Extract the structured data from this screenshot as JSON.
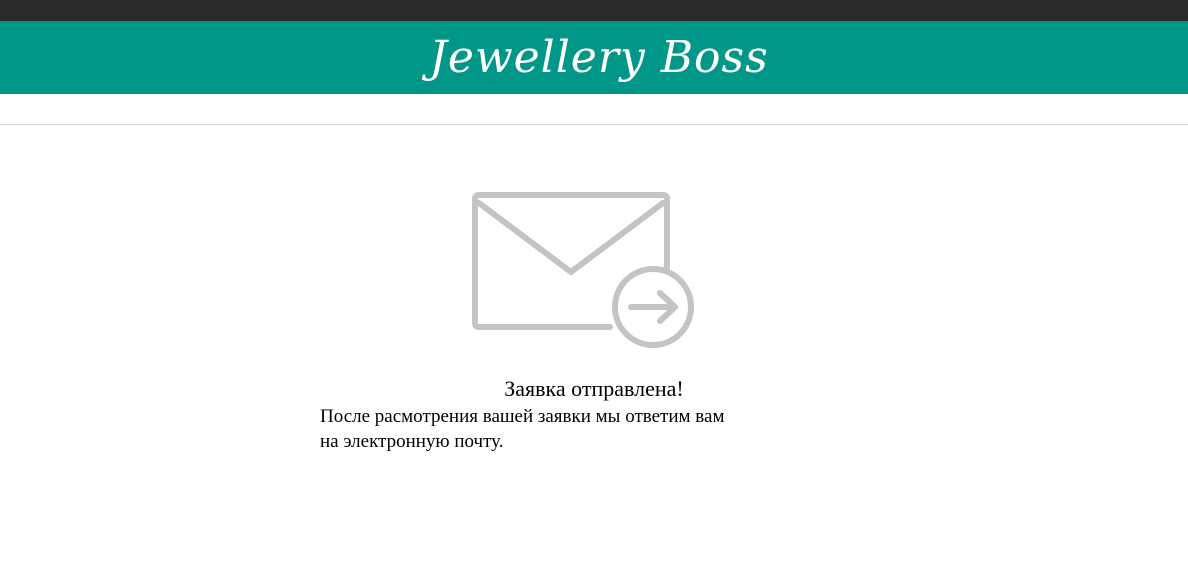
{
  "header": {
    "logo_text": "Jewellery Boss",
    "background_color": "#009688",
    "topbar_color": "#2a2a2a"
  },
  "confirmation": {
    "icon": "mail-sent-icon",
    "title": "Заявка отправлена!",
    "message_line1": "После расмотрения вашей заявки мы ответим вам",
    "message_line2": "на электронную почту."
  }
}
